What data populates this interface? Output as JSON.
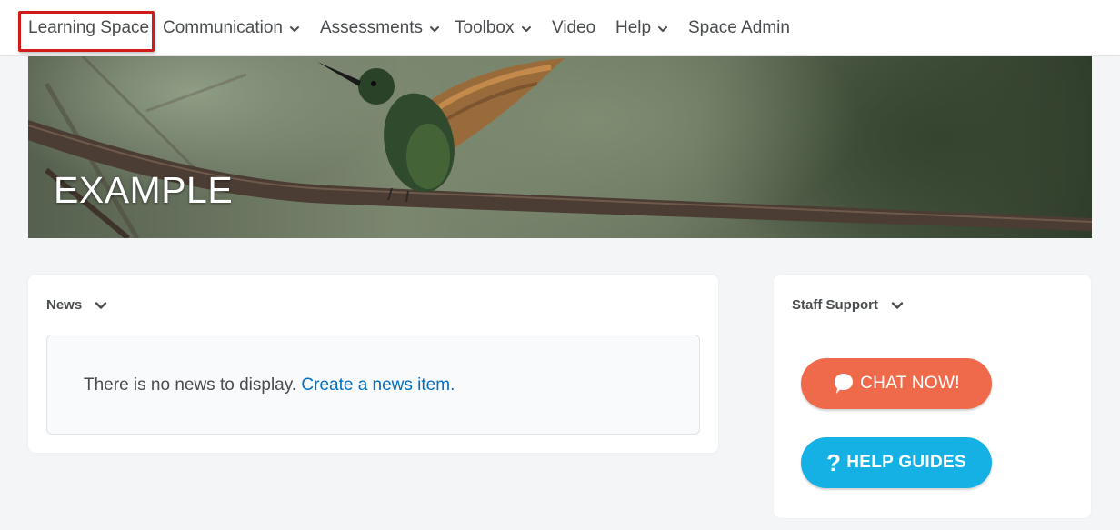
{
  "nav": {
    "items": [
      {
        "label": "Learning Space",
        "has_dropdown": false,
        "highlighted": true
      },
      {
        "label": "Communication",
        "has_dropdown": true
      },
      {
        "label": "Assessments",
        "has_dropdown": true
      },
      {
        "label": "Toolbox",
        "has_dropdown": true
      },
      {
        "label": "Video",
        "has_dropdown": false
      },
      {
        "label": "Help",
        "has_dropdown": true
      },
      {
        "label": "Space Admin",
        "has_dropdown": false
      }
    ]
  },
  "hero": {
    "title": "EXAMPLE",
    "image": "hummingbird-on-branch"
  },
  "news": {
    "title": "News",
    "empty_text": "There is no news to display.",
    "create_link": "Create a news item."
  },
  "staff_support": {
    "title": "Staff Support",
    "chat_button": "CHAT NOW!",
    "help_button": "HELP GUIDES"
  },
  "colors": {
    "highlight_border": "#d01b1b",
    "link": "#006fbf",
    "chat_button": "#ef6a4a",
    "help_button": "#15b1e5",
    "page_background": "#f4f5f7"
  },
  "icons": {
    "dropdown": "chevron-down-icon",
    "chat": "speech-bubble-icon",
    "help": "question-mark-icon"
  }
}
